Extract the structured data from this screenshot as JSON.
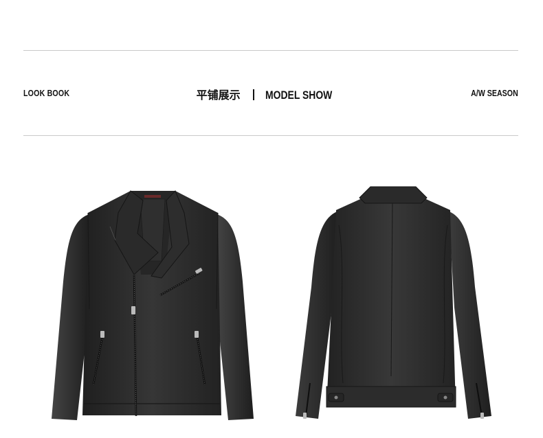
{
  "header": {
    "left_label": "LOOK BOOK",
    "title_cn": "平铺展示",
    "title_en": "MODEL SHOW",
    "right_label": "A/W SEASON"
  },
  "products": [
    {
      "view": "front",
      "icon": "leather-jacket-front-image",
      "color": "#2c2c2c"
    },
    {
      "view": "back",
      "icon": "leather-jacket-back-image",
      "color": "#2e2e2e"
    }
  ]
}
